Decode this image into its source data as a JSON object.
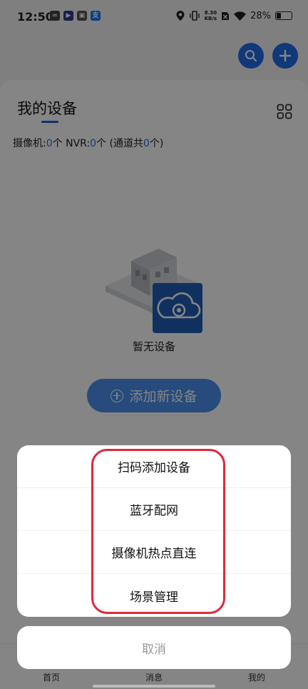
{
  "status_bar": {
    "time": "12:50",
    "net_speed_value": "8.30",
    "net_speed_unit": "KB/s",
    "battery": "28%",
    "battery_level": 0.28
  },
  "header": {
    "title": "我的设备"
  },
  "summary": {
    "camera_label": "摄像机:",
    "camera_count": "0",
    "camera_unit": "个",
    "nvr_label": " NVR:",
    "nvr_count": "0",
    "nvr_unit": "个",
    "channel_prefix": " (通道共",
    "channel_count": "0",
    "channel_suffix": "个)"
  },
  "empty_state": {
    "text": "暂无设备"
  },
  "add_button": {
    "label": "添加新设备"
  },
  "tabbar": {
    "home": "首页",
    "messages": "消息",
    "mine": "我的"
  },
  "action_sheet": {
    "items": [
      {
        "label": "扫码添加设备"
      },
      {
        "label": "蓝牙配网"
      },
      {
        "label": "摄像机热点直连"
      },
      {
        "label": "场景管理"
      }
    ],
    "cancel": "取消"
  },
  "colors": {
    "accent": "#1e6ee6",
    "highlight": "#e0283a"
  },
  "icons": [
    "search-icon",
    "plus-icon",
    "grid-view-icon",
    "cloud-camera-icon",
    "wifi-icon",
    "location-icon",
    "vibrate-icon"
  ]
}
